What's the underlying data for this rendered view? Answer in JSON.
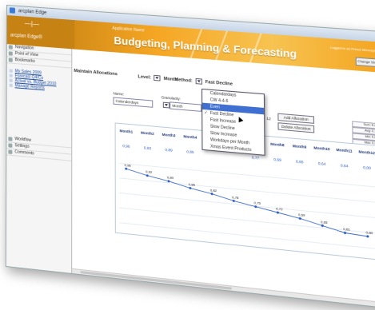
{
  "window": {
    "title": "arcplan Edge"
  },
  "banner": {
    "logo_mark": "—|—",
    "logo_text": "arcplan Edge®",
    "subtitle": "Application Name",
    "title": "Budgeting, Planning & Forecasting",
    "right_text": "Logged in as Prince Microsystems",
    "button": "Change Structure"
  },
  "sidebar": {
    "sections": [
      {
        "label": "Navigation",
        "icon": "navigation-icon"
      },
      {
        "label": "Point of View",
        "icon": "point-of-view-icon"
      },
      {
        "label": "Bookmarks",
        "icon": "bookmark-icon"
      }
    ],
    "links": [
      "My Sales 2009",
      "Forecast Q4/Co",
      "Actual vs. Budget 2010",
      "Manage Reports"
    ],
    "bottom": [
      {
        "label": "Workflow",
        "icon": "workflow-icon"
      },
      {
        "label": "Settings",
        "icon": "settings-icon"
      },
      {
        "label": "Comments",
        "icon": "comments-icon"
      }
    ]
  },
  "main": {
    "section_title": "Maintain Allocations",
    "level_label": "Level:",
    "level_value": "Month",
    "method_label": "Method:",
    "method_value": "Fast Decline",
    "name_label": "Name:",
    "name_value": "Calenderdays",
    "granularity_label": "Granularity:",
    "granularity_value": "Month",
    "period_value": "12",
    "add_button": "Add Allocation",
    "delete_button": "Delete Allocation",
    "stats": [
      "Sum: 8,22",
      "Avg: 0,77",
      "Min: 0,00",
      "Max: 0,96"
    ],
    "months": [
      "Month1",
      "Month2",
      "Month3",
      "Month4",
      "Month5",
      "Month6",
      "Month7",
      "Month8",
      "Month9",
      "Month10",
      "Month11",
      "Month12"
    ],
    "values": [
      "0,96",
      "0,93",
      "0,89",
      "0,85",
      "",
      "",
      "0,77",
      "0,69",
      "0,65",
      "0,64",
      "0,64",
      "0,00"
    ],
    "point_labels": [
      "0,96",
      "0,92",
      "0,89",
      "0,85",
      "0,82",
      "0,78",
      "0,75",
      "0,72",
      "0,69",
      "0,65",
      "0,61",
      "0,60"
    ]
  },
  "dropdown": {
    "items": [
      "Calendardays",
      "CW 4-4-5",
      "Even",
      "Fast Decline",
      "Fast Increase",
      "Slow Decline",
      "Slow Increase",
      "Workdays per Month",
      "Xmas Event Products"
    ],
    "highlighted": "Even",
    "checked": "Fast Decline"
  },
  "colors": {
    "banner": "#f5a623",
    "highlight": "#3f6fd1",
    "line": "#2a5cc4"
  }
}
